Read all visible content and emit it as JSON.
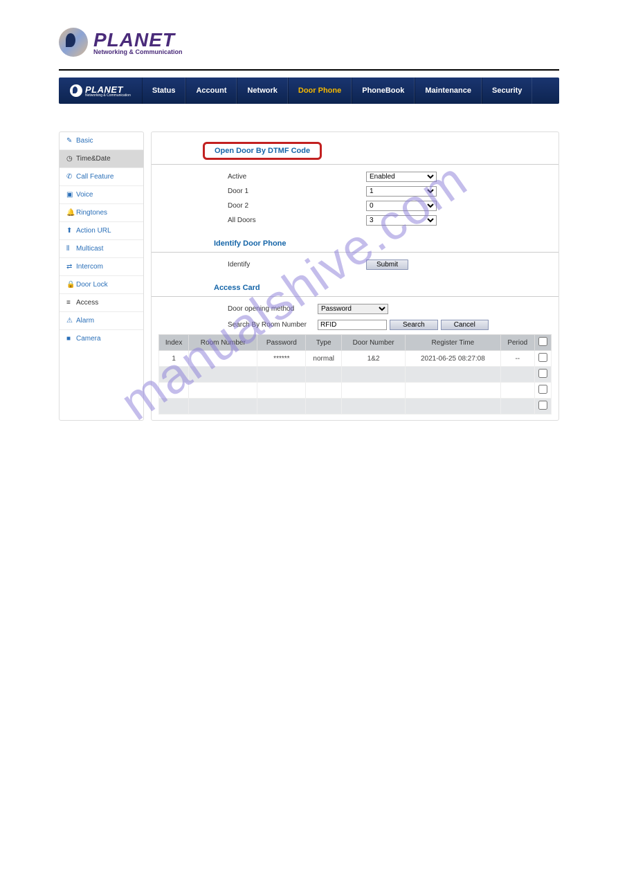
{
  "brand": {
    "name": "PLANET",
    "tagline": "Networking & Communication"
  },
  "nav": {
    "logo": "PLANET",
    "logo_sub": "Networking & Communication",
    "items": [
      "Status",
      "Account",
      "Network",
      "Door Phone",
      "PhoneBook",
      "Maintenance",
      "Security"
    ],
    "active": "Door Phone"
  },
  "sidebar": {
    "items": [
      {
        "icon": "✎",
        "label": "Basic"
      },
      {
        "icon": "◷",
        "label": "Time&Date"
      },
      {
        "icon": "✆",
        "label": "Call Feature"
      },
      {
        "icon": "▣",
        "label": "Voice"
      },
      {
        "icon": "🔔",
        "label": "Ringtones"
      },
      {
        "icon": "⬆",
        "label": "Action URL"
      },
      {
        "icon": "⫴",
        "label": "Multicast"
      },
      {
        "icon": "⇄",
        "label": "Intercom"
      },
      {
        "icon": "🔒",
        "label": "Door Lock"
      },
      {
        "icon": "≡",
        "label": "Access"
      },
      {
        "icon": "⚠",
        "label": "Alarm"
      },
      {
        "icon": "■",
        "label": "Camera"
      }
    ]
  },
  "sections": {
    "dtmf": {
      "title": "Open Door By DTMF Code",
      "active_label": "Active",
      "active_value": "Enabled",
      "door1_label": "Door 1",
      "door1_value": "1",
      "door2_label": "Door 2",
      "door2_value": "0",
      "all_label": "All Doors",
      "all_value": "3"
    },
    "identify": {
      "title": "Identify Door Phone",
      "label": "Identify",
      "button": "Submit"
    },
    "access": {
      "title": "Access Card",
      "method_label": "Door opening method",
      "method_value": "Password",
      "search_label": "Search By Room Number",
      "search_value": "RFID",
      "search_button": "Search",
      "cancel_button": "Cancel"
    }
  },
  "table": {
    "headers": [
      "Index",
      "Room Number",
      "Password",
      "Type",
      "Door Number",
      "Register Time",
      "Period"
    ],
    "rows": [
      {
        "index": "1",
        "room": "",
        "password": "******",
        "type": "normal",
        "door": "1&2",
        "time": "2021-06-25 08:27:08",
        "period": "--"
      },
      {
        "index": "",
        "room": "",
        "password": "",
        "type": "",
        "door": "",
        "time": "",
        "period": ""
      },
      {
        "index": "",
        "room": "",
        "password": "",
        "type": "",
        "door": "",
        "time": "",
        "period": ""
      },
      {
        "index": "",
        "room": "",
        "password": "",
        "type": "",
        "door": "",
        "time": "",
        "period": ""
      }
    ]
  },
  "watermark": "manualshive.com"
}
